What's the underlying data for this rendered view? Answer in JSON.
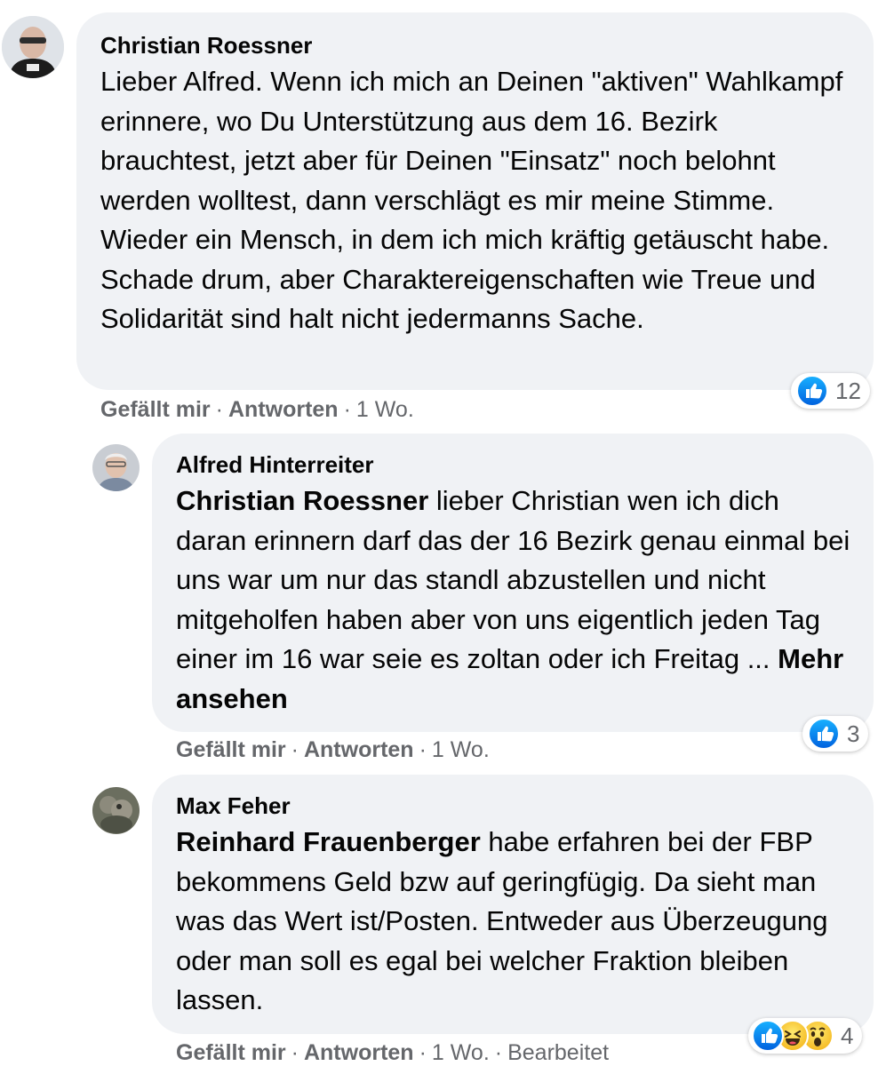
{
  "comments": [
    {
      "author": "Christian Roessner",
      "text": "Lieber Alfred. Wenn ich mich an Deinen \"aktiven\" Wahlkampf erinnere, wo Du Unterstützung aus dem 16. Bezirk brauchtest, jetzt aber für Deinen \"Einsatz\" noch belohnt werden wolltest, dann verschlägt es mir meine Stimme. Wieder ein Mensch, in dem ich mich kräftig getäuscht habe. Schade drum, aber Charaktereigenschaften wie Treue und Solidarität sind halt nicht jedermanns Sache.",
      "like_label": "Gefällt mir",
      "reply_label": "Antworten",
      "time": "1 Wo.",
      "reaction_count": "12",
      "reaction_icons": [
        "like-icon"
      ]
    },
    {
      "author": "Alfred Hinterreiter",
      "mention": "Christian Roessner",
      "text": " lieber Christian wen ich dich daran erinnern darf das der 16 Bezirk genau einmal bei uns war um nur das standl abzustellen und nicht mitgeholfen haben aber von uns eigentlich jeden Tag einer im 16 war seie es zoltan oder ich Freitag ... ",
      "more_label": "Mehr ansehen",
      "like_label": "Gefällt mir",
      "reply_label": "Antworten",
      "time": "1 Wo.",
      "reaction_count": "3",
      "reaction_icons": [
        "like-icon"
      ]
    },
    {
      "author": "Max Feher",
      "mention": "Reinhard Frauenberger",
      "text": " habe erfahren bei der FBP bekommens Geld bzw auf geringfügig. Da sieht man was das Wert ist/Posten. Entweder aus Überzeugung oder man soll es egal bei welcher Fraktion bleiben lassen.",
      "like_label": "Gefällt mir",
      "reply_label": "Antworten",
      "time": "1 Wo.",
      "edited_label": "Bearbeitet",
      "reaction_count": "4",
      "reaction_icons": [
        "like-icon",
        "haha-icon",
        "wow-icon"
      ]
    }
  ],
  "separator": "·",
  "colors": {
    "bubble": "#f0f2f5",
    "meta": "#65676b",
    "like_blue": "#1877f2"
  }
}
